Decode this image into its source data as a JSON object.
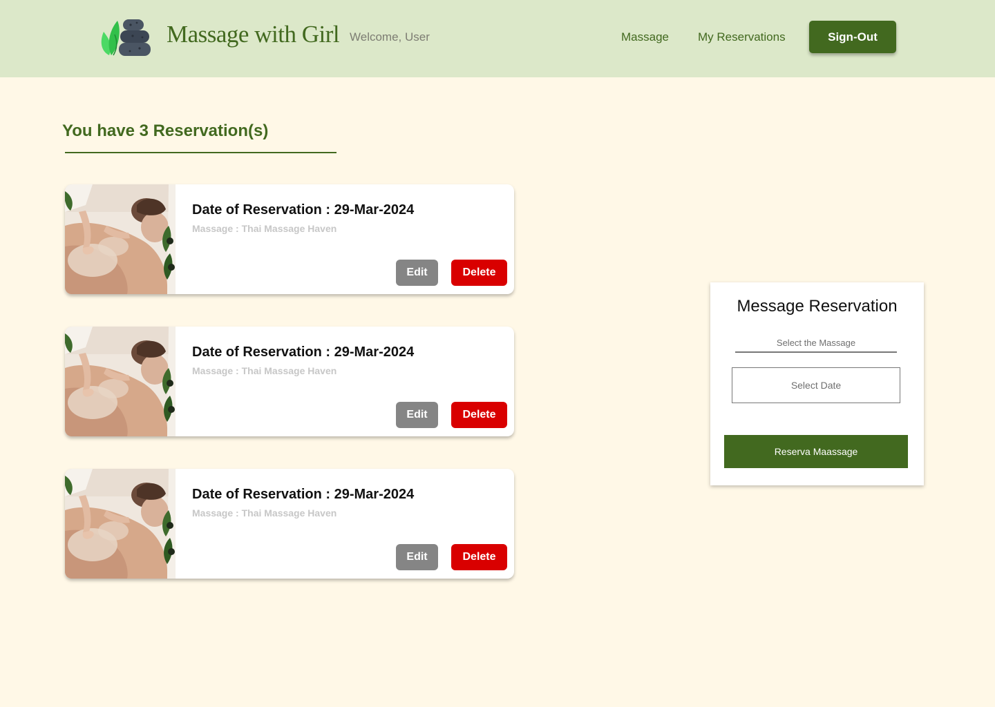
{
  "header": {
    "brand": "Massage with Girl",
    "welcome": "Welcome, User",
    "nav": {
      "massage": "Massage",
      "my_reservations": "My Reservations"
    },
    "signout_label": "Sign-Out"
  },
  "main": {
    "title": "You have 3 Reservation(s)",
    "reservations": [
      {
        "date": "Date of Reservation : 29-Mar-2024",
        "massage": "Massage : Thai Massage Haven",
        "edit_label": "Edit",
        "delete_label": "Delete",
        "image": "massage-photo"
      },
      {
        "date": "Date of Reservation : 29-Mar-2024",
        "massage": "Massage : Thai Massage Haven",
        "edit_label": "Edit",
        "delete_label": "Delete",
        "image": "massage-photo"
      },
      {
        "date": "Date of Reservation : 29-Mar-2024",
        "massage": "Massage : Thai Massage Haven",
        "edit_label": "Edit",
        "delete_label": "Delete",
        "image": "massage-photo"
      }
    ]
  },
  "reservation_form": {
    "title": "Message Reservation",
    "massage_placeholder": "Select the Massage",
    "date_placeholder": "Select Date",
    "submit_label": "Reserva Maassage"
  },
  "colors": {
    "header_bg": "#dce8c9",
    "page_bg": "#fff8e7",
    "brand_green": "#42691f",
    "edit_gray": "#858585",
    "delete_red": "#d90000"
  },
  "icons": {
    "logo": "stones-leaf-logo-icon"
  }
}
